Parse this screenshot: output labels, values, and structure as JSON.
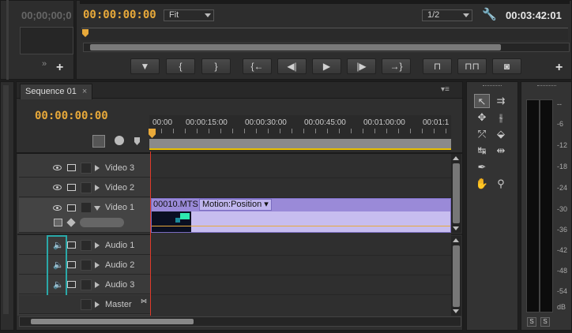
{
  "source_monitor": {
    "timecode": "00;00;00;0"
  },
  "program_monitor": {
    "current_timecode": "00:00:00:00",
    "zoom_select": "Fit",
    "resolution_select": "1/2",
    "duration_timecode": "00:03:42:01",
    "controls": [
      "marker",
      "in-point",
      "out-point",
      "go-to-in",
      "step-back",
      "play",
      "step-forward",
      "go-to-out",
      "lift",
      "extract",
      "export-frame"
    ]
  },
  "sequence": {
    "tab_label": "Sequence 01",
    "close_glyph": "×",
    "menu_glyph": "▾≡",
    "timecode": "00:00:00:00",
    "ruler_ticks": [
      "00:00",
      "00:00:15:00",
      "00:00:30:00",
      "00:00:45:00",
      "00:01:00:00",
      "00:01:1"
    ],
    "video_tracks": [
      {
        "label": "Video 3"
      },
      {
        "label": "Video 2"
      },
      {
        "label": "Video 1"
      }
    ],
    "audio_tracks": [
      {
        "label": "Audio 1"
      },
      {
        "label": "Audio 2"
      },
      {
        "label": "Audio 3"
      }
    ],
    "master_label": "Master",
    "clip": {
      "name": "00010.MTS",
      "effect": "Motion:Position",
      "color": "#a999e0"
    }
  },
  "tools": [
    "selection",
    "track-select",
    "ripple-edit",
    "rolling-edit",
    "rate-stretch",
    "razor",
    "slip",
    "slide",
    "pen",
    "hand",
    "zoom"
  ],
  "audio_meter": {
    "scale": [
      "--",
      "-6",
      "-12",
      "-18",
      "-24",
      "-30",
      "-36",
      "-42",
      "-48",
      "-54",
      "dB"
    ],
    "solo_labels": [
      "S",
      "S"
    ]
  },
  "colors": {
    "accent_timecode": "#e8a93a",
    "playhead": "#e03a2a",
    "selected_outline": "#2aa8a8"
  }
}
